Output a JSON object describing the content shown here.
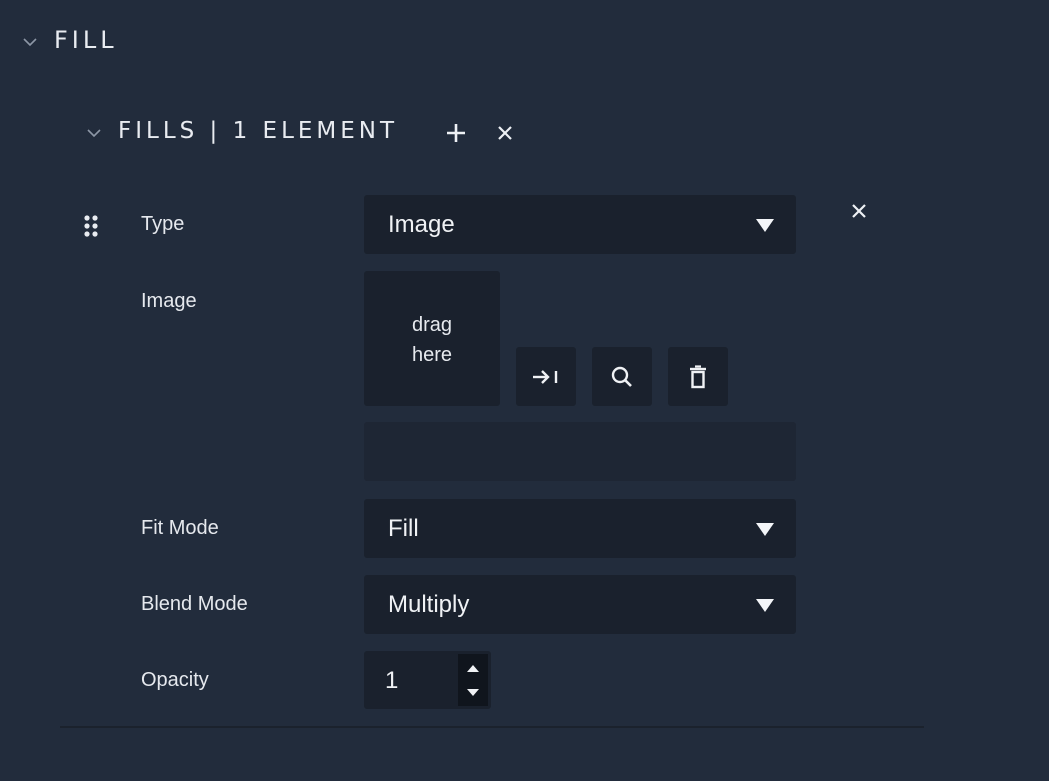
{
  "section": {
    "title": "FILL",
    "chevron_icon": "chevron-down-icon"
  },
  "fills": {
    "title": "FILLS | 1 ELEMENT",
    "add_icon": "plus-icon",
    "remove_icon": "close-icon"
  },
  "element": {
    "drag_handle_icon": "drag-handle-icon",
    "remove_icon": "close-icon",
    "type": {
      "label": "Type",
      "value": "Image"
    },
    "image": {
      "label": "Image",
      "drop_text_line1": "drag",
      "drop_text_line2": "here",
      "path_value": "",
      "buttons": [
        "assign-icon",
        "search-icon",
        "trash-icon"
      ]
    },
    "fit_mode": {
      "label": "Fit Mode",
      "value": "Fill"
    },
    "blend_mode": {
      "label": "Blend Mode",
      "value": "Multiply"
    },
    "opacity": {
      "label": "Opacity",
      "value": "1"
    }
  },
  "colors": {
    "background": "#222c3c",
    "field": "#1a212d",
    "text": "#e6e9ee"
  }
}
